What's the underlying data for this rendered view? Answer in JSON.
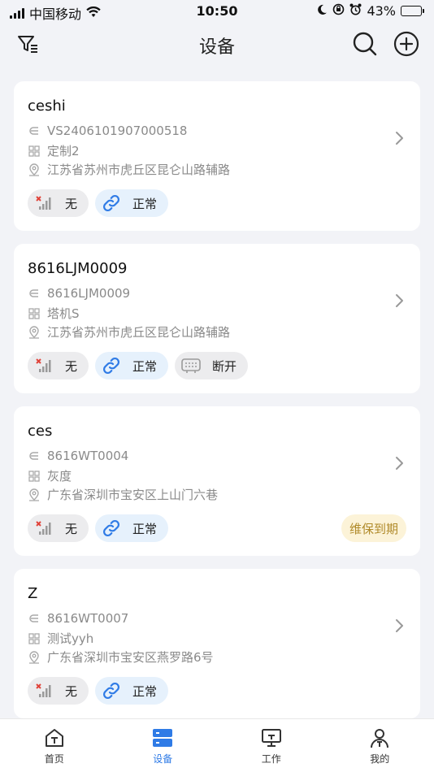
{
  "status_bar": {
    "carrier": "中国移动",
    "time": "10:50",
    "battery_percent": "43%",
    "battery_level": 0.43
  },
  "header": {
    "title": "设备",
    "left_icon": "filter-icon",
    "right_icons": [
      "search-icon",
      "add-icon"
    ]
  },
  "devices": [
    {
      "name": "ceshi",
      "code": "VS2406101907000518",
      "model": "定制2",
      "address": "江苏省苏州市虎丘区昆仑山路辅路",
      "tags": [
        {
          "kind": "signal",
          "label": "无",
          "style": "grey"
        },
        {
          "kind": "link",
          "label": "正常",
          "style": "blue"
        }
      ],
      "badge": ""
    },
    {
      "name": "8616LJM0009",
      "code": "8616LJM0009",
      "model": "塔机S",
      "address": "江苏省苏州市虎丘区昆仑山路辅路",
      "tags": [
        {
          "kind": "signal",
          "label": "无",
          "style": "grey"
        },
        {
          "kind": "link",
          "label": "正常",
          "style": "blue"
        },
        {
          "kind": "router",
          "label": "断开",
          "style": "grey"
        }
      ],
      "badge": ""
    },
    {
      "name": "ces",
      "code": "8616WT0004",
      "model": "灰度",
      "address": "广东省深圳市宝安区上山门六巷",
      "tags": [
        {
          "kind": "signal",
          "label": "无",
          "style": "grey"
        },
        {
          "kind": "link",
          "label": "正常",
          "style": "blue"
        }
      ],
      "badge": "维保到期"
    },
    {
      "name": "Z",
      "code": "8616WT0007",
      "model": "测试yyh",
      "address": "广东省深圳市宝安区燕罗路6号",
      "tags": [
        {
          "kind": "signal",
          "label": "无",
          "style": "grey"
        },
        {
          "kind": "link",
          "label": "正常",
          "style": "blue"
        }
      ],
      "badge": ""
    }
  ],
  "tabbar": {
    "items": [
      {
        "label": "首页",
        "icon": "home-icon",
        "active": false
      },
      {
        "label": "设备",
        "icon": "device-icon",
        "active": true
      },
      {
        "label": "工作",
        "icon": "monitor-icon",
        "active": false
      },
      {
        "label": "我的",
        "icon": "profile-icon",
        "active": false
      }
    ]
  },
  "colors": {
    "accent": "#2f7be6",
    "background": "#f2f3f7",
    "badge_bg": "#fcf3d8",
    "badge_text": "#b08a2a",
    "signal_off": "#e0433a"
  }
}
